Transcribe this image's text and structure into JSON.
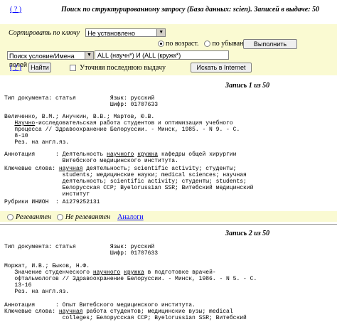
{
  "header": {
    "help": "( ? )",
    "title": "Поиск по структурированному запросу (База данных: scien).   Записей в выдаче: 50"
  },
  "sort": {
    "label": "Сортировать по ключу",
    "value": "Не установлено",
    "asc_label": "по возраст.",
    "desc_label": "по убыванию",
    "run_label": "Выполнить"
  },
  "search": {
    "field": "Поиск условие/Имена полей",
    "query": "ALL (научн*) И (ALL (кружк*)",
    "help": "( ? )",
    "find_label": "Найти",
    "refine_label": "Уточняя последнюю выдачу",
    "internet_label": "Искать в Internet"
  },
  "records": [
    {
      "title": "Запись 1 из 50",
      "l1": "Тип документа: статья          Язык: русский",
      "l2": "                               Шифр: 01707633",
      "l3": "Величенко, В.М.; Анучкин, В.В.; Мартов, Ю.В.",
      "l4a": "   ",
      "l4b": "Научно",
      "l4c": "-исследовательская работа студентов и оптимизация учебного",
      "l5": "   процесса // Здравоохранение Белоруссии. - Минск, 1985. - N 9. - С.",
      "l6": "   8-10",
      "l7": "   Рез. на англ.яз.",
      "ann1a": "Аннотация      : Деятельность ",
      "ann1b": "научного",
      "ann1c": " ",
      "ann1d": "кружка",
      "ann1e": " кафедры общей хирургии",
      "ann2": "                 Витебского медицинского института.",
      "kw1a": "Ключевые слова: ",
      "kw1b": "научная",
      "kw1c": " деятельность; scientific activity; студенты;",
      "kw2": "                 students; медицинские науки; medical sciences; научная",
      "kw3": "                 деятельность; scientific activity; студенты; students;",
      "kw4": "                 Белорусская ССР; Byelorussian SSR; Витебский медицинский",
      "kw5": "                 институт",
      "rub": "Рубрики ИНИОН  : А1279252131",
      "rel": "Релевантен",
      "nrel": "Не релевантен",
      "analog": "Аналоги"
    },
    {
      "title": "Запись 2 из 50",
      "l1": "Тип документа: статья          Язык: русский",
      "l2": "                               Шифр: 01707633",
      "l3": "Моржат, И.В.; Быков, Н.Ф.",
      "l4a": "   Значение студенческого ",
      "l4b": "научного",
      "l4c": " ",
      "l4d": "кружка",
      "l4e": " в подготовке врачей-",
      "l5": "   офтальмологов // Здравоохранение Белоруссии. - Минск, 1986. - N 5. - С.",
      "l6": "   13-16",
      "l7": "   Рез. на англ.яз.",
      "ann": "Аннотация      : Опыт Витебского медицинского института.",
      "kw1a": "Ключевые слова: ",
      "kw1b": "научная",
      "kw1c": " работа студентов; медицинские вузы; medical",
      "kw2": "                 colleges; Белорусская ССР; Byelorussian SSR; Витебский"
    }
  ]
}
